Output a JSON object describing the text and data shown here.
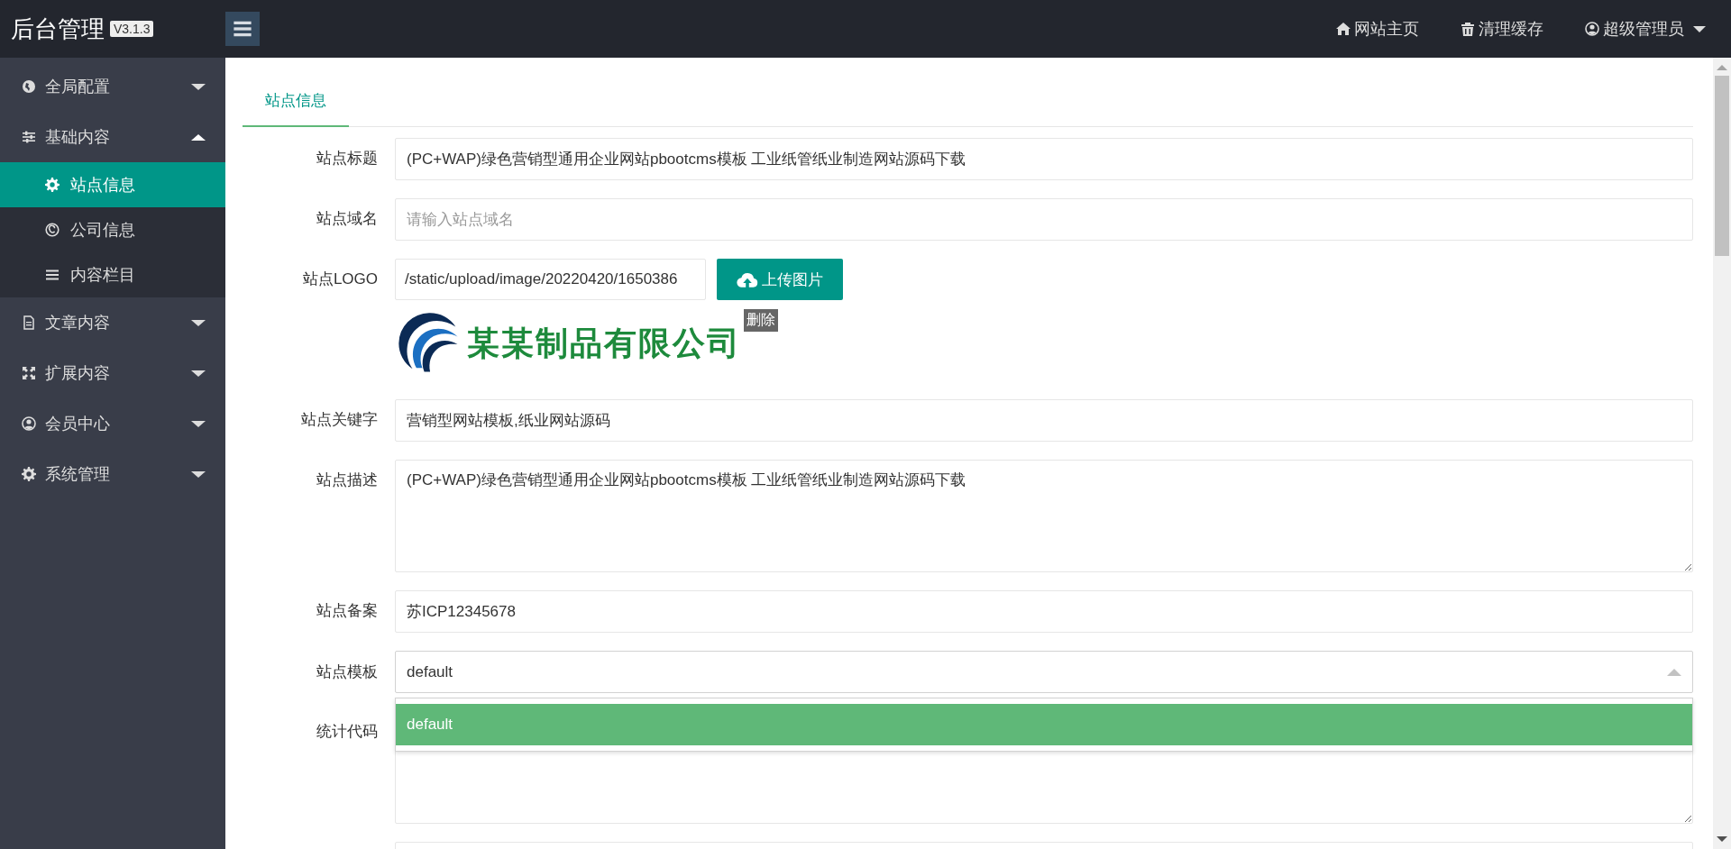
{
  "header": {
    "title": "后台管理",
    "version": "V3.1.3",
    "links": [
      {
        "label": "网站主页",
        "dropdown": false
      },
      {
        "label": "清理缓存",
        "dropdown": false
      },
      {
        "label": "超级管理员",
        "dropdown": true
      }
    ]
  },
  "sidebar": {
    "items": [
      {
        "label": "全局配置",
        "expanded": false
      },
      {
        "label": "基础内容",
        "expanded": true,
        "children": [
          {
            "label": "站点信息",
            "selected": true
          },
          {
            "label": "公司信息",
            "selected": false
          },
          {
            "label": "内容栏目",
            "selected": false
          }
        ]
      },
      {
        "label": "文章内容",
        "expanded": false
      },
      {
        "label": "扩展内容",
        "expanded": false
      },
      {
        "label": "会员中心",
        "expanded": false
      },
      {
        "label": "系统管理",
        "expanded": false
      }
    ]
  },
  "tabs": [
    {
      "label": "站点信息",
      "selected": true
    }
  ],
  "form": {
    "fields": [
      {
        "kind": "text",
        "label": "站点标题",
        "value": "(PC+WAP)绿色营销型通用企业网站pbootcms模板 工业纸管纸业制造网站源码下载"
      },
      {
        "kind": "text",
        "label": "站点域名",
        "placeholder": "请输入站点域名"
      },
      {
        "kind": "upload",
        "label": "站点LOGO",
        "value": "/static/upload/image/20220420/1650386",
        "button": "上传图片",
        "delete": "删除",
        "preview_text": "某某制品有限公司"
      },
      {
        "kind": "text",
        "label": "站点关键字",
        "value": "营销型网站模板,纸业网站源码"
      },
      {
        "kind": "textarea",
        "label": "站点描述",
        "value": "(PC+WAP)绿色营销型通用企业网站pbootcms模板 工业纸管纸业制造网站源码下载"
      },
      {
        "kind": "text",
        "label": "站点备案",
        "value": "苏ICP12345678"
      },
      {
        "kind": "select",
        "label": "站点模板",
        "value": "default",
        "expanded": true,
        "options": [
          {
            "label": "default",
            "selected": true
          }
        ]
      },
      {
        "kind": "textarea",
        "label": "统计代码"
      },
      {
        "kind": "text"
      }
    ]
  }
}
